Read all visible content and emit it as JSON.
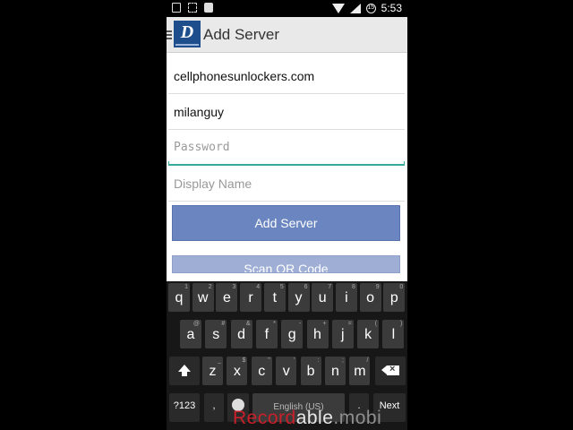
{
  "status_bar": {
    "time": "5:53",
    "battery": "15"
  },
  "app": {
    "title": "Add Server"
  },
  "form": {
    "server": "cellphonesunlockers.com",
    "username": "milanguy",
    "password_placeholder": "Password",
    "display_name_placeholder": "Display Name",
    "add_button": "Add Server",
    "scan_button": "Scan QR Code"
  },
  "keyboard": {
    "row1": [
      {
        "k": "q",
        "h": "1"
      },
      {
        "k": "w",
        "h": "2"
      },
      {
        "k": "e",
        "h": "3"
      },
      {
        "k": "r",
        "h": "4"
      },
      {
        "k": "t",
        "h": "5"
      },
      {
        "k": "y",
        "h": "6"
      },
      {
        "k": "u",
        "h": "7"
      },
      {
        "k": "i",
        "h": "8"
      },
      {
        "k": "o",
        "h": "9"
      },
      {
        "k": "p",
        "h": "0"
      }
    ],
    "row2": [
      {
        "k": "a",
        "h": "@"
      },
      {
        "k": "s",
        "h": "#"
      },
      {
        "k": "d",
        "h": "&"
      },
      {
        "k": "f",
        "h": "*"
      },
      {
        "k": "g",
        "h": "-"
      },
      {
        "k": "h",
        "h": "+"
      },
      {
        "k": "j",
        "h": "="
      },
      {
        "k": "k",
        "h": "("
      },
      {
        "k": "l",
        "h": ")"
      }
    ],
    "row3": [
      {
        "k": "z",
        "h": "_"
      },
      {
        "k": "x",
        "h": "$"
      },
      {
        "k": "c",
        "h": "\""
      },
      {
        "k": "v",
        "h": "'"
      },
      {
        "k": "b",
        "h": ":"
      },
      {
        "k": "n",
        "h": ";"
      },
      {
        "k": "m",
        "h": "/"
      }
    ],
    "symbols_key": "?123",
    "comma_key": ",",
    "space_label": "English (US)",
    "period_key": ".",
    "next_key": "Next"
  },
  "watermark": {
    "part1": "Record",
    "part2": "able",
    "part3": ".mobi"
  }
}
